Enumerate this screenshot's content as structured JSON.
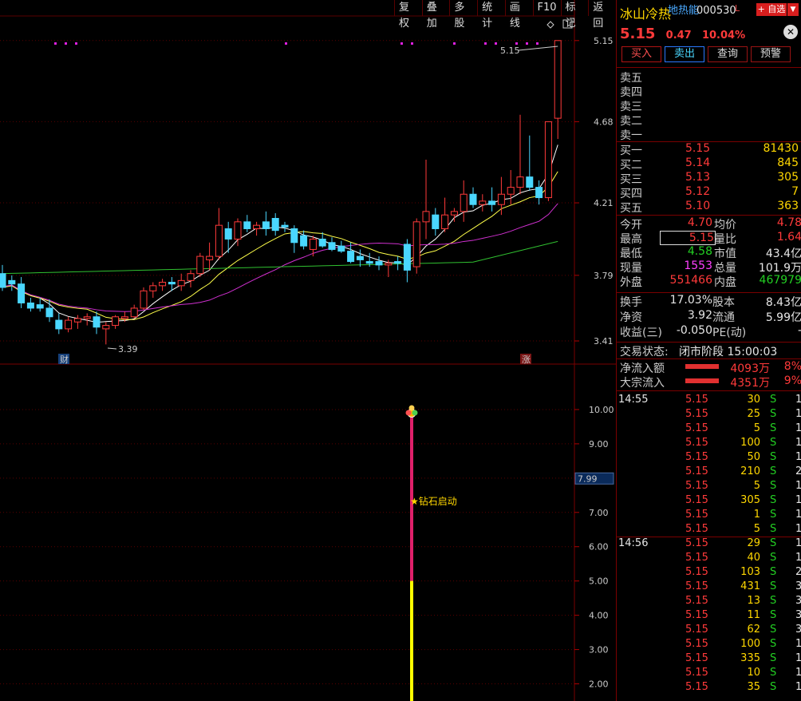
{
  "toolbar": [
    "复权",
    "叠加",
    "多股",
    "统计",
    "画线",
    "F10",
    "标记",
    "返回"
  ],
  "stock": {
    "name": "冰山冷热",
    "tag": "地热能",
    "code": "000530",
    "tag_l": "L",
    "fav_label": "+ 自选",
    "price": "5.15",
    "change": "0.47",
    "change_pct": "10.04%"
  },
  "trade_buttons": [
    "买入",
    "卖出",
    "查询",
    "预警"
  ],
  "sell_levels": [
    {
      "label": "卖五",
      "price": "",
      "vol": ""
    },
    {
      "label": "卖四",
      "price": "",
      "vol": ""
    },
    {
      "label": "卖三",
      "price": "",
      "vol": ""
    },
    {
      "label": "卖二",
      "price": "",
      "vol": ""
    },
    {
      "label": "卖一",
      "price": "",
      "vol": ""
    }
  ],
  "buy_levels": [
    {
      "label": "买一",
      "price": "5.15",
      "vol": "81430"
    },
    {
      "label": "买二",
      "price": "5.14",
      "vol": "845"
    },
    {
      "label": "买三",
      "price": "5.13",
      "vol": "305"
    },
    {
      "label": "买四",
      "price": "5.12",
      "vol": "7"
    },
    {
      "label": "买五",
      "price": "5.10",
      "vol": "363"
    }
  ],
  "stats": [
    {
      "l1": "今开",
      "v1": "4.70",
      "c1": "red",
      "l2": "均价",
      "v2": "4.78",
      "c2": "red"
    },
    {
      "l1": "最高",
      "v1": "5.15",
      "c1": "red",
      "l2": "量比",
      "v2": "1.64",
      "c2": "red"
    },
    {
      "l1": "最低",
      "v1": "4.58",
      "c1": "green",
      "l2": "市值",
      "v2": "43.4亿",
      "c2": "white"
    },
    {
      "l1": "现量",
      "v1": "1553",
      "c1": "magenta",
      "l2": "总量",
      "v2": "101.9万",
      "c2": "white"
    },
    {
      "l1": "外盘",
      "v1": "551466",
      "c1": "red",
      "l2": "内盘",
      "v2": "467979",
      "c2": "green"
    }
  ],
  "stats2": [
    {
      "l1": "换手",
      "v1": "17.03%",
      "l2": "股本",
      "v2": "8.43亿"
    },
    {
      "l1": "净资",
      "v1": "3.92",
      "l2": "流通",
      "v2": "5.99亿"
    },
    {
      "l1": "收益(三)",
      "v1": "-0.050",
      "l2": "PE(动)",
      "v2": "-"
    }
  ],
  "status": {
    "label": "交易状态:",
    "value": "闭市阶段 15:00:03"
  },
  "flows": [
    {
      "label": "净流入额",
      "value": "4093万",
      "pct": "8%"
    },
    {
      "label": "大宗流入",
      "value": "4351万",
      "pct": "9%"
    }
  ],
  "ticks": [
    {
      "t": "14:55",
      "p": "5.15",
      "v": "30",
      "s": "S",
      "n": "1"
    },
    {
      "t": "",
      "p": "5.15",
      "v": "25",
      "s": "S",
      "n": "1"
    },
    {
      "t": "",
      "p": "5.15",
      "v": "5",
      "s": "S",
      "n": "1"
    },
    {
      "t": "",
      "p": "5.15",
      "v": "100",
      "s": "S",
      "n": "1"
    },
    {
      "t": "",
      "p": "5.15",
      "v": "50",
      "s": "S",
      "n": "1"
    },
    {
      "t": "",
      "p": "5.15",
      "v": "210",
      "s": "S",
      "n": "2"
    },
    {
      "t": "",
      "p": "5.15",
      "v": "5",
      "s": "S",
      "n": "1"
    },
    {
      "t": "",
      "p": "5.15",
      "v": "305",
      "s": "S",
      "n": "1"
    },
    {
      "t": "",
      "p": "5.15",
      "v": "1",
      "s": "S",
      "n": "1"
    },
    {
      "t": "",
      "p": "5.15",
      "v": "5",
      "s": "S",
      "n": "1"
    },
    {
      "t": "14:56",
      "p": "5.15",
      "v": "29",
      "s": "S",
      "n": "1"
    },
    {
      "t": "",
      "p": "5.15",
      "v": "40",
      "s": "S",
      "n": "1"
    },
    {
      "t": "",
      "p": "5.15",
      "v": "103",
      "s": "S",
      "n": "2"
    },
    {
      "t": "",
      "p": "5.15",
      "v": "431",
      "s": "S",
      "n": "3"
    },
    {
      "t": "",
      "p": "5.15",
      "v": "13",
      "s": "S",
      "n": "3"
    },
    {
      "t": "",
      "p": "5.15",
      "v": "11",
      "s": "S",
      "n": "3"
    },
    {
      "t": "",
      "p": "5.15",
      "v": "62",
      "s": "S",
      "n": "3"
    },
    {
      "t": "",
      "p": "5.15",
      "v": "100",
      "s": "S",
      "n": "1"
    },
    {
      "t": "",
      "p": "5.15",
      "v": "335",
      "s": "S",
      "n": "1"
    },
    {
      "t": "",
      "p": "5.15",
      "v": "10",
      "s": "S",
      "n": "1"
    },
    {
      "t": "",
      "p": "5.15",
      "v": "35",
      "s": "S",
      "n": "1"
    }
  ],
  "chart_data": {
    "type": "candlestick",
    "price_axis_ticks": [
      "5.15",
      "4.68",
      "4.21",
      "3.79",
      "3.41"
    ],
    "price_range": [
      3.35,
      5.2
    ],
    "high_label": "5.15",
    "low_label": "3.39",
    "markers": [
      "财",
      "涨"
    ],
    "candles": [
      {
        "o": 3.8,
        "h": 3.85,
        "l": 3.7,
        "c": 3.72
      },
      {
        "o": 3.76,
        "h": 3.79,
        "l": 3.7,
        "c": 3.74
      },
      {
        "o": 3.74,
        "h": 3.78,
        "l": 3.6,
        "c": 3.63
      },
      {
        "o": 3.63,
        "h": 3.66,
        "l": 3.58,
        "c": 3.6
      },
      {
        "o": 3.62,
        "h": 3.66,
        "l": 3.58,
        "c": 3.6
      },
      {
        "o": 3.6,
        "h": 3.65,
        "l": 3.52,
        "c": 3.55
      },
      {
        "o": 3.53,
        "h": 3.57,
        "l": 3.45,
        "c": 3.48
      },
      {
        "o": 3.48,
        "h": 3.55,
        "l": 3.46,
        "c": 3.53
      },
      {
        "o": 3.52,
        "h": 3.56,
        "l": 3.48,
        "c": 3.54
      },
      {
        "o": 3.54,
        "h": 3.57,
        "l": 3.5,
        "c": 3.55
      },
      {
        "o": 3.55,
        "h": 3.58,
        "l": 3.45,
        "c": 3.49
      },
      {
        "o": 3.48,
        "h": 3.52,
        "l": 3.39,
        "c": 3.5
      },
      {
        "o": 3.5,
        "h": 3.56,
        "l": 3.48,
        "c": 3.55
      },
      {
        "o": 3.54,
        "h": 3.58,
        "l": 3.52,
        "c": 3.55
      },
      {
        "o": 3.55,
        "h": 3.62,
        "l": 3.54,
        "c": 3.6
      },
      {
        "o": 3.6,
        "h": 3.72,
        "l": 3.59,
        "c": 3.7
      },
      {
        "o": 3.7,
        "h": 3.75,
        "l": 3.66,
        "c": 3.73
      },
      {
        "o": 3.73,
        "h": 3.77,
        "l": 3.7,
        "c": 3.75
      },
      {
        "o": 3.75,
        "h": 3.78,
        "l": 3.7,
        "c": 3.74
      },
      {
        "o": 3.73,
        "h": 3.8,
        "l": 3.7,
        "c": 3.76
      },
      {
        "o": 3.76,
        "h": 3.82,
        "l": 3.72,
        "c": 3.8
      },
      {
        "o": 3.8,
        "h": 3.92,
        "l": 3.78,
        "c": 3.9
      },
      {
        "o": 3.88,
        "h": 3.98,
        "l": 3.82,
        "c": 3.9
      },
      {
        "o": 3.9,
        "h": 4.18,
        "l": 3.88,
        "c": 4.08
      },
      {
        "o": 4.06,
        "h": 4.1,
        "l": 3.92,
        "c": 4.0
      },
      {
        "o": 4.0,
        "h": 4.12,
        "l": 3.96,
        "c": 4.1
      },
      {
        "o": 4.1,
        "h": 4.14,
        "l": 4.04,
        "c": 4.06
      },
      {
        "o": 4.06,
        "h": 4.1,
        "l": 4.02,
        "c": 4.08
      },
      {
        "o": 4.1,
        "h": 4.16,
        "l": 4.02,
        "c": 4.06
      },
      {
        "o": 4.12,
        "h": 4.15,
        "l": 4.02,
        "c": 4.05
      },
      {
        "o": 4.08,
        "h": 4.1,
        "l": 4.04,
        "c": 4.07
      },
      {
        "o": 4.06,
        "h": 4.08,
        "l": 3.92,
        "c": 3.98
      },
      {
        "o": 4.02,
        "h": 4.05,
        "l": 3.94,
        "c": 3.96
      },
      {
        "o": 3.94,
        "h": 4.02,
        "l": 3.9,
        "c": 4.0
      },
      {
        "o": 4.0,
        "h": 4.04,
        "l": 3.95,
        "c": 3.96
      },
      {
        "o": 3.98,
        "h": 4.01,
        "l": 3.93,
        "c": 3.94
      },
      {
        "o": 3.96,
        "h": 3.99,
        "l": 3.92,
        "c": 3.93
      },
      {
        "o": 3.93,
        "h": 3.98,
        "l": 3.86,
        "c": 3.87
      },
      {
        "o": 3.9,
        "h": 3.94,
        "l": 3.84,
        "c": 3.88
      },
      {
        "o": 3.87,
        "h": 3.92,
        "l": 3.84,
        "c": 3.86
      },
      {
        "o": 3.87,
        "h": 3.9,
        "l": 3.82,
        "c": 3.85
      },
      {
        "o": 3.85,
        "h": 3.88,
        "l": 3.78,
        "c": 3.86
      },
      {
        "o": 3.87,
        "h": 3.9,
        "l": 3.82,
        "c": 3.86
      },
      {
        "o": 3.97,
        "h": 4.0,
        "l": 3.75,
        "c": 3.82
      },
      {
        "o": 3.84,
        "h": 4.12,
        "l": 3.8,
        "c": 4.1
      },
      {
        "o": 4.1,
        "h": 4.46,
        "l": 4.0,
        "c": 4.16
      },
      {
        "o": 4.14,
        "h": 4.18,
        "l": 4.02,
        "c": 4.06
      },
      {
        "o": 4.06,
        "h": 4.24,
        "l": 4.04,
        "c": 4.14
      },
      {
        "o": 4.14,
        "h": 4.18,
        "l": 4.1,
        "c": 4.16
      },
      {
        "o": 4.16,
        "h": 4.34,
        "l": 4.1,
        "c": 4.26
      },
      {
        "o": 4.26,
        "h": 4.3,
        "l": 4.18,
        "c": 4.2
      },
      {
        "o": 4.2,
        "h": 4.26,
        "l": 4.16,
        "c": 4.22
      },
      {
        "o": 4.22,
        "h": 4.3,
        "l": 4.16,
        "c": 4.2
      },
      {
        "o": 4.2,
        "h": 4.36,
        "l": 4.14,
        "c": 4.26
      },
      {
        "o": 4.26,
        "h": 4.4,
        "l": 4.2,
        "c": 4.3
      },
      {
        "o": 4.3,
        "h": 4.72,
        "l": 4.26,
        "c": 4.36
      },
      {
        "o": 4.36,
        "h": 4.6,
        "l": 4.28,
        "c": 4.3
      },
      {
        "o": 4.3,
        "h": 4.34,
        "l": 4.2,
        "c": 4.24
      },
      {
        "o": 4.24,
        "h": 4.5,
        "l": 4.22,
        "c": 4.68
      },
      {
        "o": 4.7,
        "h": 5.15,
        "l": 4.58,
        "c": 5.15
      }
    ],
    "indicator": {
      "axis_ticks": [
        "10.00",
        "9.00",
        "8.00",
        "7.00",
        "6.00",
        "5.00",
        "4.00",
        "3.00",
        "2.00"
      ],
      "current_value": "7.99",
      "signal_label": "★钻石启动",
      "range": [
        1.5,
        11.0
      ],
      "bar": {
        "top": 9.8,
        "magenta_to": 5.0,
        "bottom": 1.5
      }
    }
  }
}
